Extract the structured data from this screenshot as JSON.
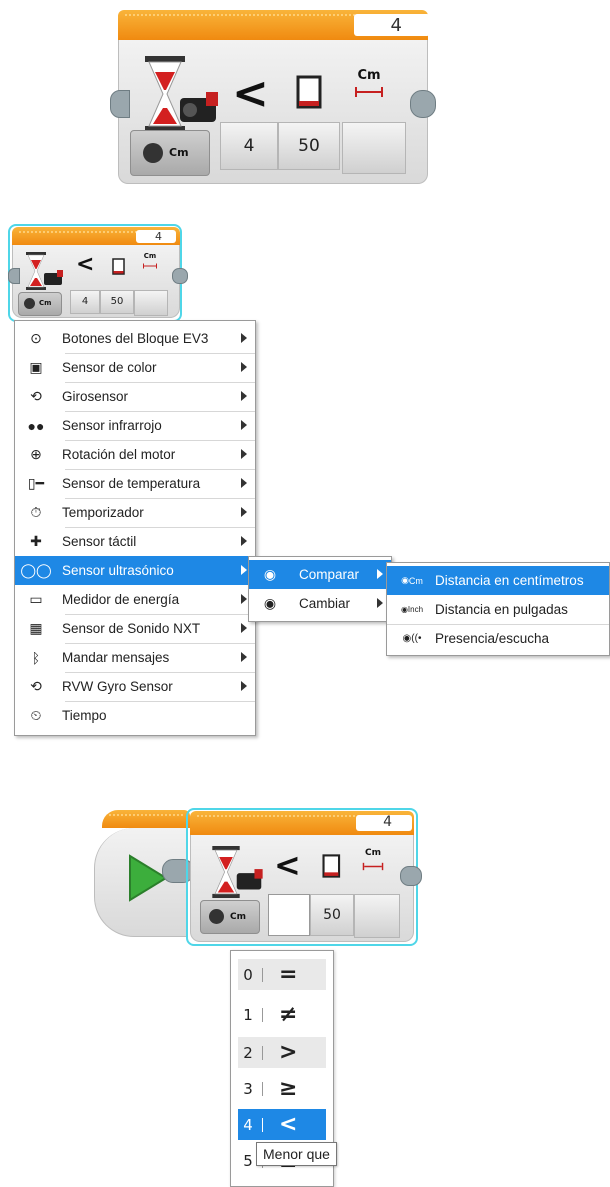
{
  "block_large": {
    "port": "4",
    "operator": "<",
    "unit": "Cm",
    "mode": "Cm",
    "params": [
      "4",
      "50"
    ]
  },
  "block_small": {
    "port": "4",
    "operator": "<",
    "unit": "Cm",
    "mode": "Cm",
    "params": [
      "4",
      "50"
    ]
  },
  "sensor_menu": {
    "items": [
      {
        "label": "Botones del Bloque EV3",
        "icon": "brick-buttons-icon"
      },
      {
        "label": "Sensor de color",
        "icon": "color-sensor-icon"
      },
      {
        "label": "Girosensor",
        "icon": "gyro-sensor-icon"
      },
      {
        "label": "Sensor infrarrojo",
        "icon": "infrared-sensor-icon"
      },
      {
        "label": "Rotación del motor",
        "icon": "motor-rotation-icon"
      },
      {
        "label": "Sensor de temperatura",
        "icon": "temperature-sensor-icon"
      },
      {
        "label": "Temporizador",
        "icon": "timer-icon"
      },
      {
        "label": "Sensor táctil",
        "icon": "touch-sensor-icon"
      },
      {
        "label": "Sensor ultrasónico",
        "icon": "ultrasonic-sensor-icon",
        "selected": true
      },
      {
        "label": "Medidor de energía",
        "icon": "energy-meter-icon"
      },
      {
        "label": "Sensor de Sonido NXT",
        "icon": "nxt-sound-sensor-icon"
      },
      {
        "label": "Mandar mensajes",
        "icon": "bluetooth-icon"
      },
      {
        "label": "RVW Gyro Sensor",
        "icon": "rvw-gyro-icon"
      },
      {
        "label": "Tiempo",
        "icon": "stopwatch-icon"
      }
    ]
  },
  "submenu": {
    "items": [
      {
        "label": "Comparar",
        "selected": true
      },
      {
        "label": "Cambiar"
      }
    ]
  },
  "submenu2": {
    "items": [
      {
        "label": "Distancia en centímetros",
        "tag": "Cm",
        "selected": true
      },
      {
        "label": "Distancia en pulgadas",
        "tag": "Inch"
      },
      {
        "label": "Presencia/escucha",
        "tag": "((•"
      }
    ]
  },
  "block_bottom": {
    "port": "4",
    "operator": "<",
    "unit": "Cm",
    "mode": "Cm",
    "param2": "50"
  },
  "compare_dropdown": {
    "options": [
      {
        "num": "0",
        "sym": "="
      },
      {
        "num": "1",
        "sym": "≠"
      },
      {
        "num": "2",
        "sym": ">"
      },
      {
        "num": "3",
        "sym": "≥"
      },
      {
        "num": "4",
        "sym": "<",
        "selected": true
      },
      {
        "num": "5",
        "sym": "≤"
      }
    ],
    "tooltip": "Menor que"
  },
  "colors": {
    "accent": "#1e88e5",
    "block_header": "#f39a1a",
    "selection_outline": "#4fd6e8",
    "start_arrow": "#3cae3c"
  }
}
